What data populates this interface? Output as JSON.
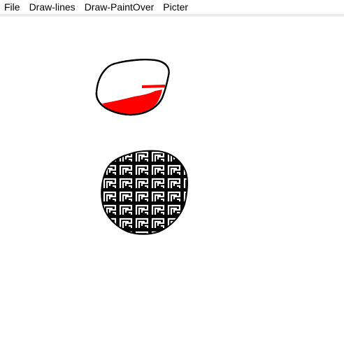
{
  "menubar": {
    "items": [
      {
        "label": "File"
      },
      {
        "label": "Draw-lines"
      },
      {
        "label": "Draw-PaintOver"
      },
      {
        "label": "Picter"
      }
    ]
  },
  "colors": {
    "background": "#ffffff",
    "stroke": "#000000",
    "red_fill": "#ff0000",
    "pattern_dark": "#000000",
    "pattern_light": "#ffffff"
  },
  "drawing": {
    "shapes": [
      {
        "name": "outline-blob",
        "fill": "red-partial",
        "icon": "freehand-shape"
      },
      {
        "name": "pattern-blob",
        "fill": "greek-key-pattern",
        "icon": "freehand-shape"
      }
    ]
  }
}
